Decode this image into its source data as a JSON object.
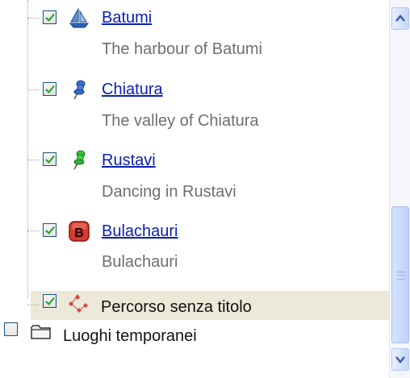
{
  "tree": {
    "places": [
      {
        "name": "Batumi",
        "description": "The harbour of Batumi",
        "icon": "sailboat-icon",
        "checked": true
      },
      {
        "name": "Chiatura",
        "description": "The valley of Chiatura",
        "icon": "blue-pushpin-icon",
        "checked": true
      },
      {
        "name": "Rustavi",
        "description": "Dancing in Rustavi",
        "icon": "green-pushpin-icon",
        "checked": true
      },
      {
        "name": "Bulachauri",
        "description": "Bulachauri",
        "icon": "red-b-placemark-icon",
        "checked": true
      }
    ],
    "route": {
      "label": "Percorso senza titolo",
      "icon": "path-route-icon",
      "checked": true,
      "selected": true
    },
    "temporary_folder": {
      "label": "Luoghi temporanei",
      "icon": "folder-icon",
      "checked": false
    }
  },
  "scrollbar": {
    "up_icon": "chevron-up-icon",
    "down_icon": "chevron-down-icon",
    "thumb_icon": "grip-icon"
  },
  "colors": {
    "link": "#0a1fb5",
    "description": "#6f6f6f",
    "selection": "#ece9d8",
    "check": "#21a121"
  }
}
